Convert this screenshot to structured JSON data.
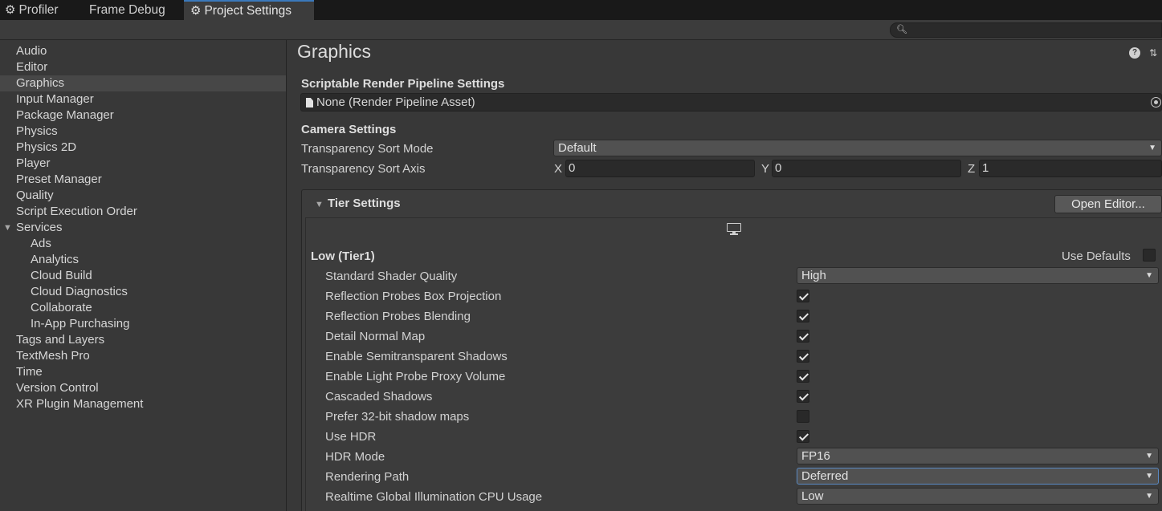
{
  "tabs": [
    {
      "label": "Profiler",
      "icon": "profiler-icon"
    },
    {
      "label": "Frame Debug",
      "icon": ""
    },
    {
      "label": "Project Settings",
      "icon": "gear-icon"
    }
  ],
  "search": {
    "placeholder": "",
    "icon": "search-icon"
  },
  "sidebar": {
    "items": [
      {
        "label": "Audio",
        "level": 0
      },
      {
        "label": "Editor",
        "level": 0
      },
      {
        "label": "Graphics",
        "level": 0,
        "selected": true
      },
      {
        "label": "Input Manager",
        "level": 0
      },
      {
        "label": "Package Manager",
        "level": 0
      },
      {
        "label": "Physics",
        "level": 0
      },
      {
        "label": "Physics 2D",
        "level": 0
      },
      {
        "label": "Player",
        "level": 0
      },
      {
        "label": "Preset Manager",
        "level": 0
      },
      {
        "label": "Quality",
        "level": 0
      },
      {
        "label": "Script Execution Order",
        "level": 0
      },
      {
        "label": "Services",
        "level": 0,
        "expanded": true
      },
      {
        "label": "Ads",
        "level": 1
      },
      {
        "label": "Analytics",
        "level": 1
      },
      {
        "label": "Cloud Build",
        "level": 1
      },
      {
        "label": "Cloud Diagnostics",
        "level": 1
      },
      {
        "label": "Collaborate",
        "level": 1
      },
      {
        "label": "In-App Purchasing",
        "level": 1
      },
      {
        "label": "Tags and Layers",
        "level": 0
      },
      {
        "label": "TextMesh Pro",
        "level": 0
      },
      {
        "label": "Time",
        "level": 0
      },
      {
        "label": "Version Control",
        "level": 0
      },
      {
        "label": "XR Plugin Management",
        "level": 0
      }
    ]
  },
  "main": {
    "title": "Graphics",
    "help_icon": "?",
    "presets_icon": "presets-icon",
    "srp": {
      "heading": "Scriptable Render Pipeline Settings",
      "value": "None (Render Pipeline Asset)"
    },
    "camera": {
      "heading": "Camera Settings",
      "sort_mode_label": "Transparency Sort Mode",
      "sort_mode_value": "Default",
      "sort_axis_label": "Transparency Sort Axis",
      "x_label": "X",
      "x_value": "0",
      "y_label": "Y",
      "y_value": "0",
      "z_label": "Z",
      "z_value": "1"
    },
    "tier": {
      "heading": "Tier Settings",
      "open_editor": "Open Editor...",
      "platform_icon": "monitor-icon",
      "tier_name": "Low (Tier1)",
      "use_defaults_label": "Use Defaults",
      "use_defaults": false,
      "rows": [
        {
          "label": "Standard Shader Quality",
          "type": "dropdown",
          "value": "High"
        },
        {
          "label": "Reflection Probes Box Projection",
          "type": "checkbox",
          "checked": true
        },
        {
          "label": "Reflection Probes Blending",
          "type": "checkbox",
          "checked": true
        },
        {
          "label": "Detail Normal Map",
          "type": "checkbox",
          "checked": true
        },
        {
          "label": "Enable Semitransparent Shadows",
          "type": "checkbox",
          "checked": true
        },
        {
          "label": "Enable Light Probe Proxy Volume",
          "type": "checkbox",
          "checked": true
        },
        {
          "label": "Cascaded Shadows",
          "type": "checkbox",
          "checked": true
        },
        {
          "label": "Prefer 32-bit shadow maps",
          "type": "checkbox",
          "checked": false
        },
        {
          "label": "Use HDR",
          "type": "checkbox",
          "checked": true
        },
        {
          "label": "HDR Mode",
          "type": "dropdown",
          "value": "FP16"
        },
        {
          "label": "Rendering Path",
          "type": "dropdown",
          "value": "Deferred",
          "focused": true
        },
        {
          "label": "Realtime Global Illumination CPU Usage",
          "type": "dropdown",
          "value": "Low"
        }
      ]
    }
  },
  "colors": {
    "accent": "#3a79bb",
    "background": "#383838",
    "selection": "#474747"
  }
}
